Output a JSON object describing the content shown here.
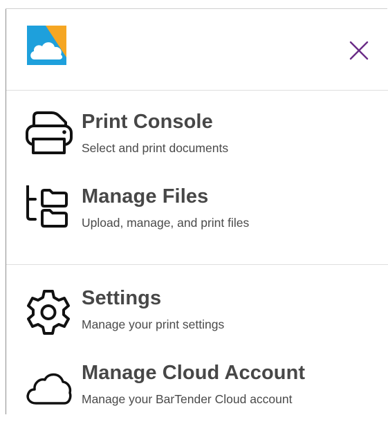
{
  "app": {
    "logo_name": "bartender-cloud-logo",
    "close_icon": "close-icon",
    "accent_color": "#6a2b86"
  },
  "menu": {
    "items": [
      {
        "title": "Print Console",
        "subtitle": "Select and print documents",
        "icon": "printer-icon"
      },
      {
        "title": "Manage Files",
        "subtitle": "Upload, manage, and print files",
        "icon": "folder-tree-icon"
      },
      {
        "title": "Settings",
        "subtitle": "Manage your print settings",
        "icon": "gear-icon"
      },
      {
        "title": "Manage Cloud Account",
        "subtitle": "Manage your BarTender Cloud account",
        "icon": "cloud-icon"
      }
    ]
  }
}
